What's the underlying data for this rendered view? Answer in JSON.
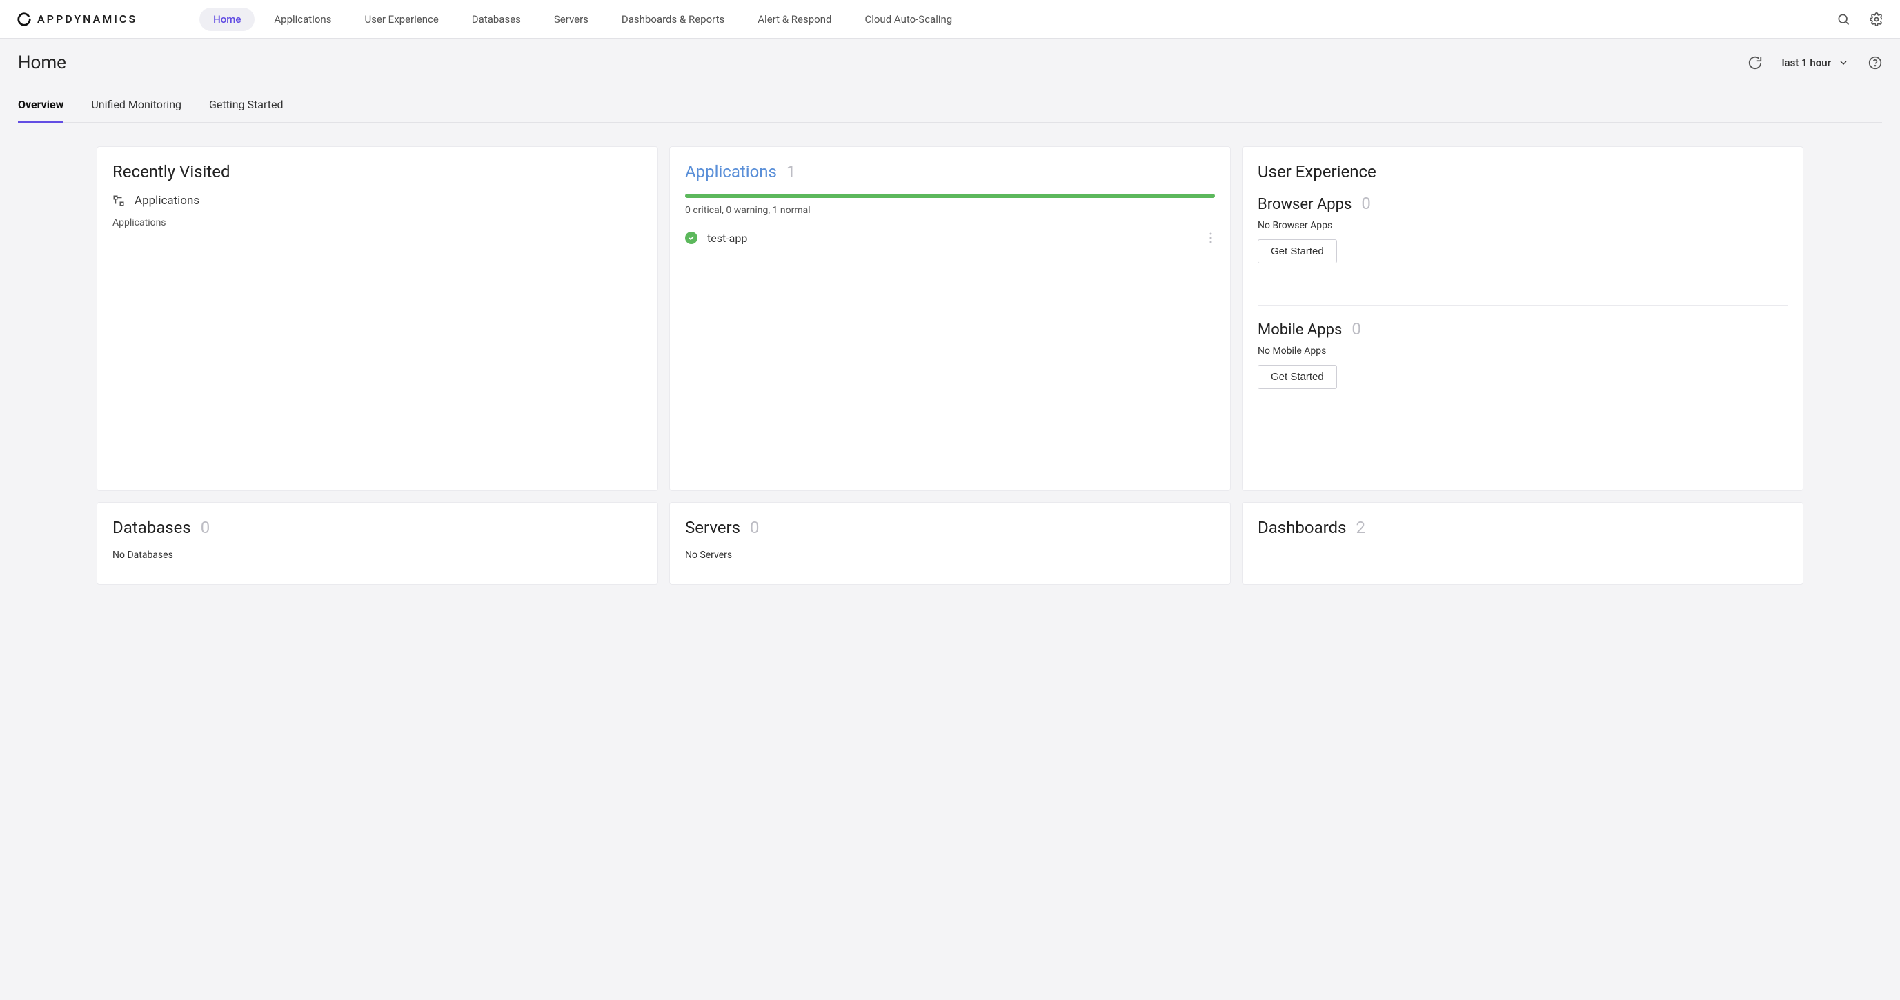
{
  "brand": "APPDYNAMICS",
  "nav": {
    "items": [
      {
        "label": "Home",
        "active": true
      },
      {
        "label": "Applications",
        "active": false
      },
      {
        "label": "User Experience",
        "active": false
      },
      {
        "label": "Databases",
        "active": false
      },
      {
        "label": "Servers",
        "active": false
      },
      {
        "label": "Dashboards & Reports",
        "active": false
      },
      {
        "label": "Alert & Respond",
        "active": false
      },
      {
        "label": "Cloud Auto-Scaling",
        "active": false
      }
    ]
  },
  "page": {
    "title": "Home",
    "time_range": "last 1 hour"
  },
  "tabs": [
    {
      "label": "Overview",
      "active": true
    },
    {
      "label": "Unified Monitoring",
      "active": false
    },
    {
      "label": "Getting Started",
      "active": false
    }
  ],
  "cards": {
    "recent": {
      "title": "Recently Visited",
      "items": [
        {
          "icon": "flow",
          "label": "Applications"
        }
      ],
      "sub": "Applications"
    },
    "applications": {
      "title": "Applications",
      "count": "1",
      "health_summary": "0 critical, 0 warning, 1 normal",
      "apps": [
        {
          "name": "test-app",
          "status": "ok"
        }
      ]
    },
    "user_experience": {
      "title": "User Experience",
      "browser": {
        "title": "Browser Apps",
        "count": "0",
        "empty": "No Browser Apps",
        "button": "Get Started"
      },
      "mobile": {
        "title": "Mobile Apps",
        "count": "0",
        "empty": "No Mobile Apps",
        "button": "Get Started"
      }
    },
    "databases": {
      "title": "Databases",
      "count": "0",
      "empty": "No Databases"
    },
    "servers": {
      "title": "Servers",
      "count": "0",
      "empty": "No Servers"
    },
    "dashboards": {
      "title": "Dashboards",
      "count": "2"
    }
  }
}
